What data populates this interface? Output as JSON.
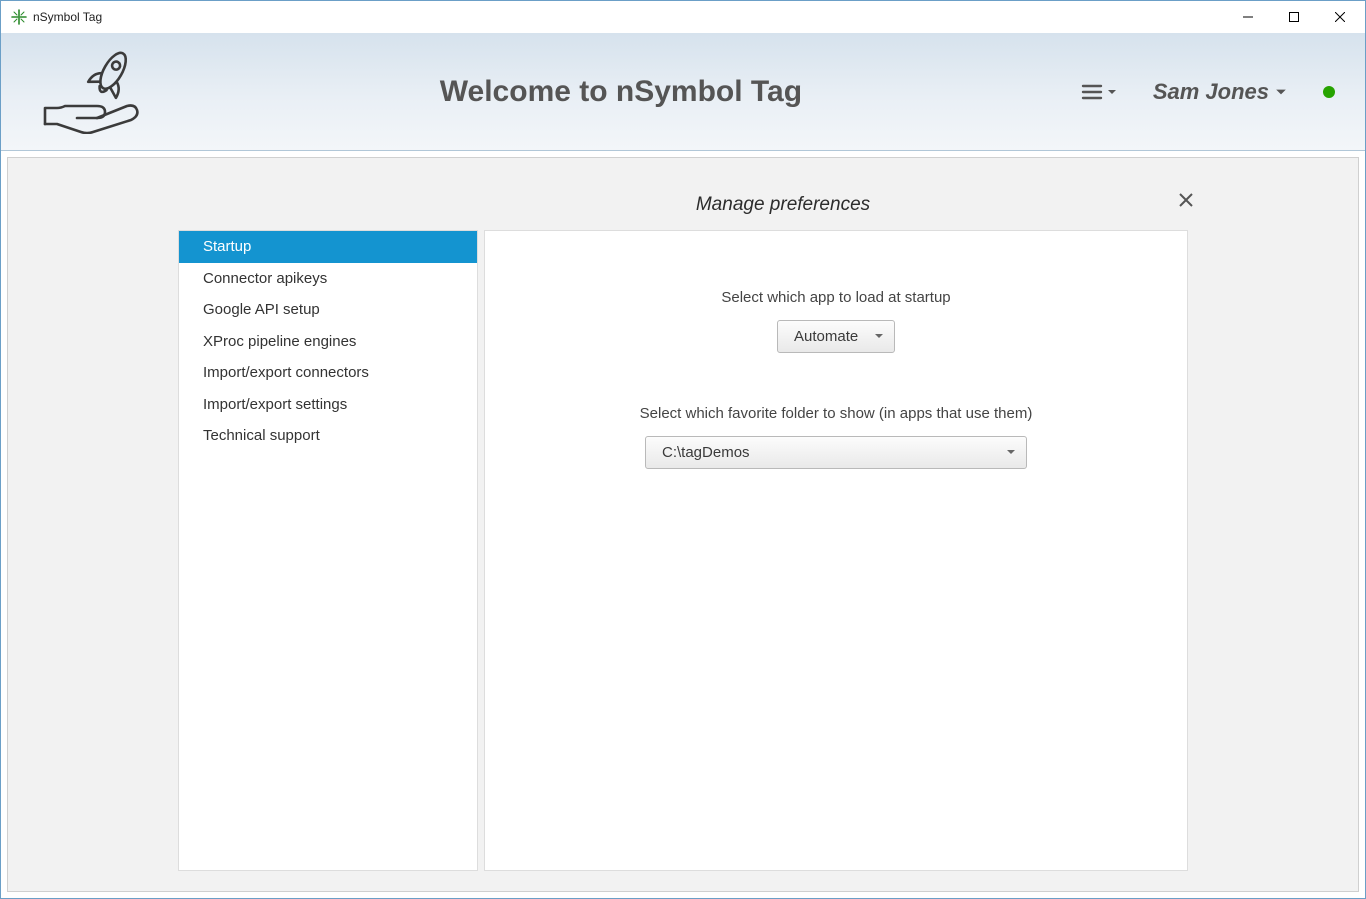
{
  "window": {
    "title": "nSymbol Tag"
  },
  "header": {
    "welcome_title": "Welcome to nSymbol Tag",
    "username": "Sam Jones"
  },
  "preferences": {
    "title": "Manage preferences",
    "sidebar": [
      {
        "label": "Startup",
        "selected": true
      },
      {
        "label": "Connector apikeys",
        "selected": false
      },
      {
        "label": "Google API setup",
        "selected": false
      },
      {
        "label": "XProc pipeline engines",
        "selected": false
      },
      {
        "label": "Import/export connectors",
        "selected": false
      },
      {
        "label": "Import/export settings",
        "selected": false
      },
      {
        "label": "Technical support",
        "selected": false
      }
    ],
    "startup": {
      "app_label": "Select which app to load at startup",
      "app_value": "Automate",
      "folder_label": "Select which favorite folder to show (in apps that use them)",
      "folder_value": "C:\\tagDemos"
    }
  }
}
